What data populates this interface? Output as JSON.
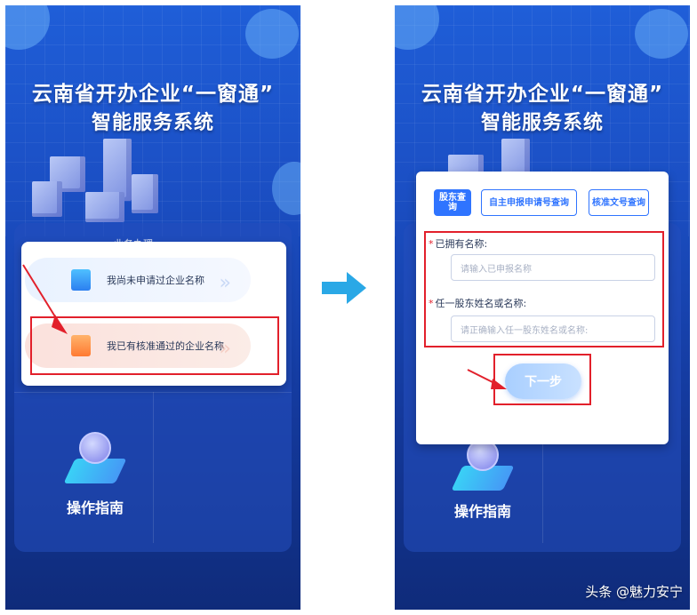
{
  "left_screen": {
    "title_line1": "云南省开办企业“一窗通”",
    "title_line2": "智能服务系统",
    "section_title_partial": "业务办理",
    "options": [
      {
        "label": "我尚未申请过企业名称",
        "icon": "document-icon"
      },
      {
        "label": "我已有核准通过的企业名称",
        "icon": "certificate-icon"
      }
    ],
    "guide_label": "操作指南"
  },
  "right_screen": {
    "title_line1": "云南省开办企业“一窗通”",
    "title_line2": "智能服务系统",
    "tabs": [
      {
        "label": "股东查询",
        "active": true
      },
      {
        "label": "自主申报申请号查询",
        "active": false
      },
      {
        "label": "核准文号查询",
        "active": false
      }
    ],
    "fields": [
      {
        "label": "已拥有名称:",
        "placeholder": "请输入已申报名称"
      },
      {
        "label": "任一股东姓名或名称:",
        "placeholder": "请正确输入任一股东姓名或名称:"
      }
    ],
    "next_button": "下一步",
    "guide_label": "操作指南"
  },
  "watermark": "头条 @魅力安宁",
  "colors": {
    "primary_blue": "#2f74ff",
    "highlight_red": "#e2202b",
    "transition_arrow": "#2aa8e6"
  }
}
